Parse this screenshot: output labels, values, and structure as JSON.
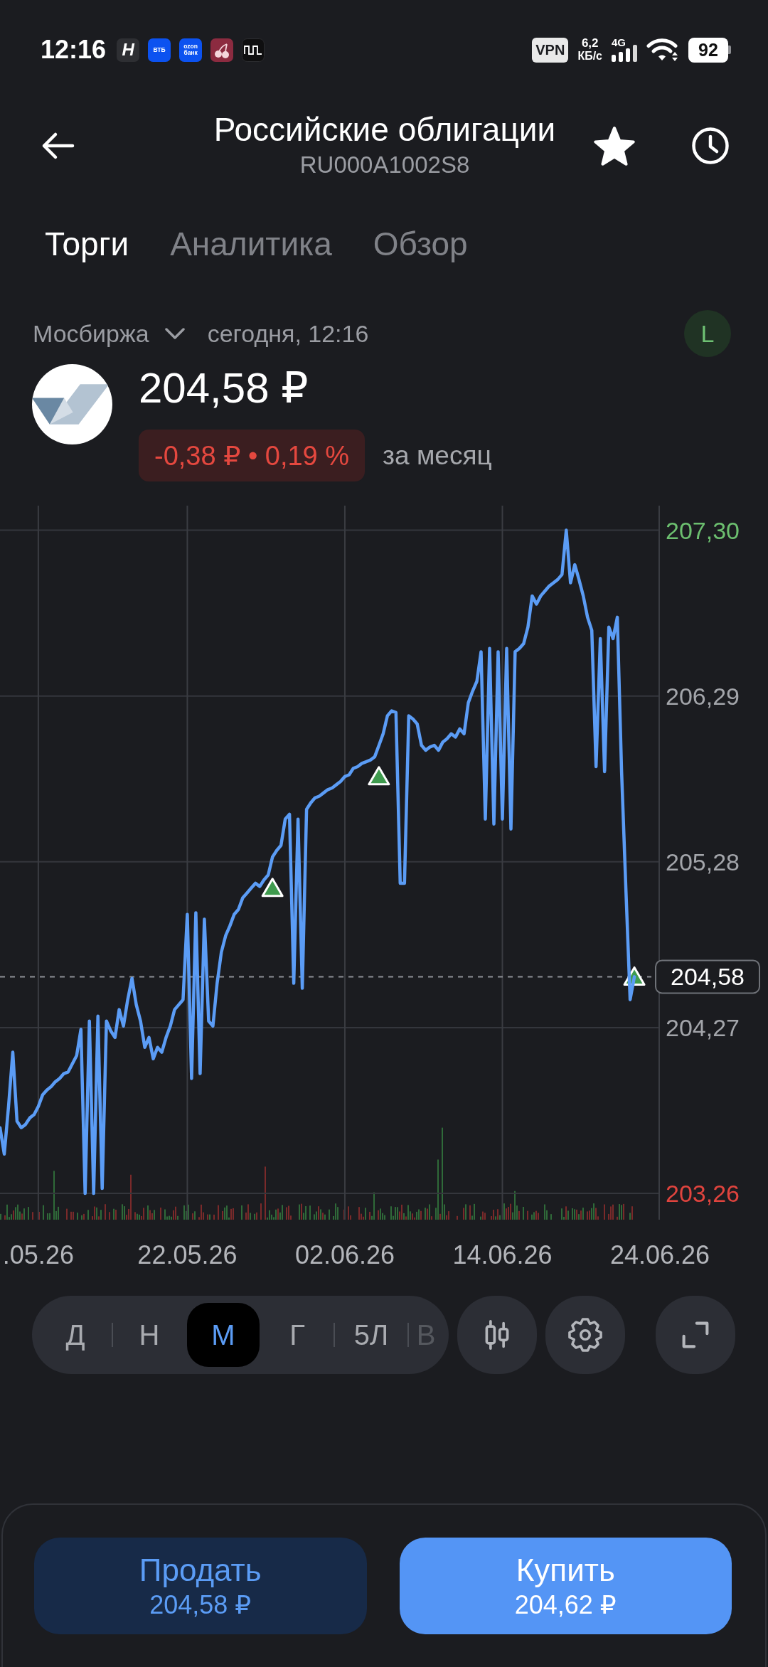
{
  "status_bar": {
    "time": "12:16",
    "notifications": [
      {
        "kind": "letter",
        "label": "H"
      },
      {
        "kind": "text",
        "label": "ВТБ"
      },
      {
        "kind": "text",
        "label": "ozon банк"
      },
      {
        "kind": "cherry"
      },
      {
        "kind": "wave"
      }
    ],
    "vpn": "VPN",
    "speed": "6,2",
    "speed_unit": "КБ/с",
    "network": "4G",
    "battery": "92"
  },
  "header": {
    "title": "Российские облигации",
    "subtitle": "RU000A1002S8",
    "favorite": true
  },
  "tabs": [
    {
      "label": "Торги",
      "selected": true
    },
    {
      "label": "Аналитика",
      "selected": false
    },
    {
      "label": "Обзор",
      "selected": false
    }
  ],
  "quote": {
    "exchange": "Мосбиржа",
    "updated": "сегодня, 12:16",
    "badge": "L",
    "price": "204,58 ₽",
    "change": {
      "text": "-0,38 ₽ • 0,19 %",
      "negative": true
    },
    "period": "за месяц"
  },
  "chart": {
    "chart_data": {
      "type": "line",
      "grid": true,
      "categories": [
        null,
        null,
        null,
        null,
        null,
        null,
        null,
        null,
        null,
        ".05.26",
        null,
        null,
        null,
        null,
        null,
        null,
        null,
        null,
        null,
        null,
        null,
        null,
        null,
        null,
        null,
        null,
        null,
        null,
        null,
        null,
        null,
        null,
        null,
        null,
        null,
        null,
        null,
        null,
        null,
        null,
        null,
        null,
        null,
        null,
        "22.05.26",
        null,
        null,
        null,
        null,
        null,
        null,
        null,
        null,
        null,
        null,
        null,
        null,
        null,
        null,
        null,
        null,
        null,
        null,
        null,
        null,
        null,
        null,
        null,
        null,
        null,
        null,
        null,
        null,
        null,
        null,
        null,
        null,
        null,
        null,
        null,
        null,
        "02.06.26",
        null,
        null,
        null,
        null,
        null,
        null,
        null,
        null,
        null,
        null,
        null,
        null,
        null,
        null,
        null,
        null,
        null,
        null,
        null,
        null,
        null,
        null,
        null,
        null,
        null,
        null,
        null,
        null,
        null,
        null,
        null,
        null,
        null,
        null,
        null,
        null,
        "14.06.26",
        null,
        null,
        null,
        null,
        null,
        null,
        null,
        null,
        null,
        null,
        null,
        null,
        null,
        null,
        null,
        null,
        null,
        null,
        null,
        null,
        null,
        null,
        null,
        null,
        null,
        null,
        null,
        null,
        null,
        null,
        null,
        null,
        null,
        null,
        null,
        null,
        "24.06.26"
      ],
      "series": [
        {
          "color": "#5b9cf5",
          "values": [
            203.66,
            203.5,
            203.79,
            204.12,
            203.7,
            203.66,
            203.68,
            203.72,
            203.74,
            203.79,
            203.86,
            203.89,
            203.91,
            203.94,
            203.96,
            203.99,
            204.0,
            204.05,
            204.1,
            204.26,
            203.26,
            204.31,
            203.26,
            204.34,
            203.29,
            204.31,
            204.25,
            204.21,
            204.38,
            204.28,
            204.44,
            204.57,
            204.41,
            204.31,
            204.15,
            204.21,
            204.08,
            204.15,
            204.12,
            204.21,
            204.28,
            204.38,
            204.41,
            204.44,
            204.96,
            203.96,
            204.97,
            203.99,
            204.93,
            204.31,
            204.28,
            204.54,
            204.73,
            204.83,
            204.89,
            204.96,
            204.99,
            205.06,
            205.09,
            205.12,
            205.15,
            205.13,
            205.17,
            205.2,
            205.31,
            205.35,
            205.38,
            205.54,
            205.57,
            204.54,
            205.54,
            204.51,
            205.6,
            205.64,
            205.67,
            205.68,
            205.7,
            205.72,
            205.73,
            205.75,
            205.77,
            205.8,
            205.81,
            205.85,
            205.86,
            205.88,
            205.89,
            205.9,
            205.92,
            205.99,
            206.06,
            206.17,
            206.2,
            206.19,
            205.15,
            205.15,
            206.17,
            206.15,
            206.12,
            205.99,
            205.96,
            205.98,
            205.99,
            205.96,
            206.01,
            206.03,
            206.06,
            206.04,
            206.09,
            206.06,
            206.25,
            206.32,
            206.38,
            206.56,
            205.54,
            206.58,
            205.51,
            206.56,
            205.54,
            206.58,
            205.48,
            206.56,
            206.58,
            206.61,
            206.71,
            206.9,
            206.85,
            206.9,
            206.93,
            206.96,
            206.98,
            207.0,
            207.03,
            207.3,
            206.98,
            207.09,
            207.0,
            206.9,
            206.77,
            206.69,
            205.86,
            206.64,
            205.83,
            206.71,
            206.64,
            206.77,
            205.83,
            205.12,
            204.44,
            204.58,
            null,
            null,
            null,
            null,
            null,
            null
          ]
        },
        {
          "type": "scatter",
          "color": "#3f9b4e",
          "values": [
            null,
            null,
            null,
            null,
            null,
            null,
            null,
            null,
            null,
            null,
            null,
            null,
            null,
            null,
            null,
            null,
            null,
            null,
            null,
            null,
            null,
            null,
            null,
            null,
            null,
            null,
            null,
            null,
            null,
            null,
            null,
            null,
            null,
            null,
            null,
            null,
            null,
            null,
            null,
            null,
            null,
            null,
            null,
            null,
            null,
            null,
            null,
            null,
            null,
            null,
            null,
            null,
            null,
            null,
            null,
            null,
            null,
            null,
            null,
            null,
            null,
            null,
            null,
            null,
            205.12,
            null,
            null,
            null,
            null,
            null,
            null,
            null,
            null,
            null,
            null,
            null,
            null,
            null,
            null,
            null,
            null,
            null,
            null,
            null,
            null,
            null,
            null,
            null,
            null,
            205.8,
            null,
            null,
            null,
            null,
            null,
            null,
            null,
            null,
            null,
            null,
            null,
            null,
            null,
            null,
            null,
            null,
            null,
            null,
            null,
            null,
            null,
            null,
            null,
            null,
            null,
            null,
            null,
            null,
            null,
            null,
            null,
            null,
            null,
            null,
            null,
            null,
            null,
            null,
            null,
            null,
            null,
            null,
            null,
            null,
            null,
            null,
            null,
            null,
            null,
            null,
            null,
            null,
            null,
            null,
            null,
            null,
            null,
            null,
            null,
            204.58,
            null,
            null,
            null,
            null,
            null,
            null
          ]
        }
      ],
      "ylim": [
        203.1,
        207.45
      ],
      "yticks": [
        {
          "value": 207.3,
          "label": "207,30"
        },
        {
          "value": 206.29,
          "label": "206,29"
        },
        {
          "value": 205.28,
          "label": "205,28"
        },
        {
          "value": 204.27,
          "label": "204,27"
        },
        {
          "value": 203.26,
          "label": "203,26"
        }
      ],
      "ref_lines": [
        {
          "axis": "y",
          "value": 204.58,
          "label": "204,58"
        }
      ]
    }
  },
  "periods": [
    {
      "label": "Д",
      "selected": false
    },
    {
      "label": "Н",
      "selected": false
    },
    {
      "label": "М",
      "selected": true
    },
    {
      "label": "Г",
      "selected": false
    },
    {
      "label": "5Л",
      "selected": false
    },
    {
      "label": "В",
      "selected": false
    }
  ],
  "trade": [
    {
      "kind": "sell",
      "label": "Продать",
      "price": "204,58 ₽"
    },
    {
      "kind": "buy",
      "label": "Купить",
      "price": "204,62 ₽"
    }
  ]
}
